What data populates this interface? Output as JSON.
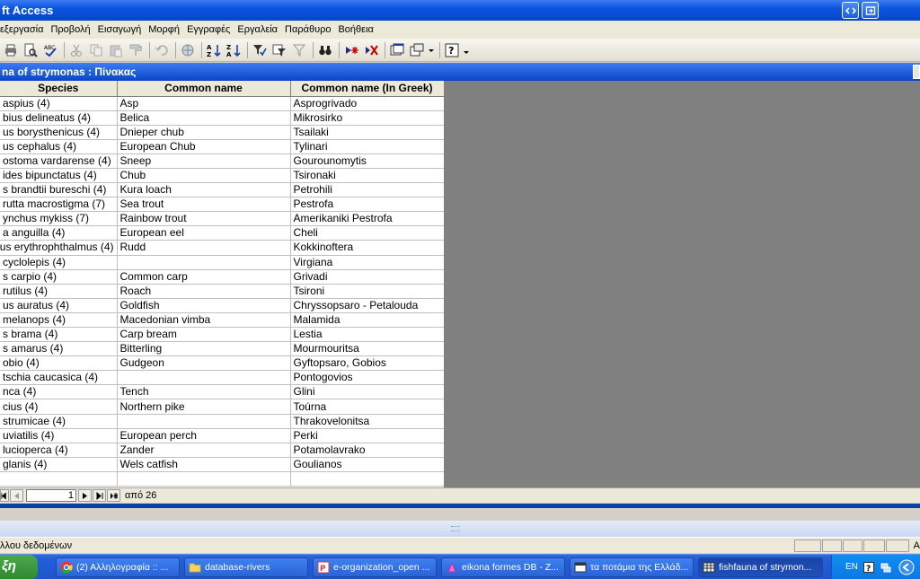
{
  "window": {
    "title": "ft Access"
  },
  "menu": [
    "εξεργασία",
    "Προβολή",
    "Εισαγωγή",
    "Μορφή",
    "Εγγραφές",
    "Εργαλεία",
    "Παράθυρο",
    "Βοήθεια"
  ],
  "child": {
    "title": "na of strymonas : Πίνακας"
  },
  "columns": [
    "Species",
    "Common name",
    "Common name (In Greek)"
  ],
  "rows": [
    [
      "aspius (4)",
      "Asp",
      "Asprogrivado"
    ],
    [
      "bius delineatus (4)",
      "Belica",
      "Mikrosirko"
    ],
    [
      "us borysthenicus (4)",
      "Dnieper chub",
      "Tsailaki"
    ],
    [
      "us cephalus (4)",
      "European Chub",
      "Tylinari"
    ],
    [
      "ostoma vardarense (4)",
      "Sneep",
      "Gourounomytis"
    ],
    [
      "ides bipunctatus (4)",
      "Chub",
      "Tsironaki"
    ],
    [
      "s brandtii bureschi (4)",
      "Kura loach",
      "Petrohili"
    ],
    [
      "rutta macrostigma (7)",
      "Sea trout",
      "Pestrofa"
    ],
    [
      "ynchus mykiss (7)",
      "Rainbow trout",
      "Amerikaniki Pestrofa"
    ],
    [
      "a anguilla (4)",
      "European eel",
      "Cheli"
    ],
    [
      "ius erythrophthalmus (4)",
      "Rudd",
      "Kokkinoftera"
    ],
    [
      "cyclolepis (4)",
      "",
      "Virgiana"
    ],
    [
      "s carpio (4)",
      "Common carp",
      "Grivadi"
    ],
    [
      "rutilus (4)",
      "Roach",
      "Tsironi"
    ],
    [
      "us auratus (4)",
      "Goldfish",
      "Chryssopsaro - Petalouda"
    ],
    [
      "melanops (4)",
      "Macedonian vimba",
      "Malamida"
    ],
    [
      "s brama (4)",
      "Carp bream",
      "Lestia"
    ],
    [
      "s amarus (4)",
      "Bitterling",
      "Mourmouritsa"
    ],
    [
      "obio (4)",
      "Gudgeon",
      "Gyftopsaro, Gobios"
    ],
    [
      "tschia caucasica (4)",
      "",
      "Pontogovios"
    ],
    [
      "nca (4)",
      "Tench",
      "Glini"
    ],
    [
      "cius (4)",
      "Northern pike",
      "Toúrna"
    ],
    [
      "strumicae (4)",
      "",
      "Thrakovelonitsa"
    ],
    [
      "uviatilis (4)",
      "European perch",
      "Perki"
    ],
    [
      "lucioperca (4)",
      "Zander",
      "Potamolavrako"
    ],
    [
      "glanis (4)",
      "Wels catfish",
      "Goulianos"
    ],
    [
      "",
      "",
      ""
    ]
  ],
  "nav": {
    "record": "1",
    "of_text": "από 26"
  },
  "status": {
    "text": "λλου δεδομένων",
    "right_letter": "A"
  },
  "taskbar": {
    "start": "ξη",
    "buttons": [
      "(2) Αλληλογραφία :: ...",
      "database-rivers",
      "e-organization_open ...",
      "eikona formes DB - Z...",
      "τα ποτάμια της Ελλάδ...",
      "fishfauna of strymon..."
    ],
    "lang": "EN"
  }
}
